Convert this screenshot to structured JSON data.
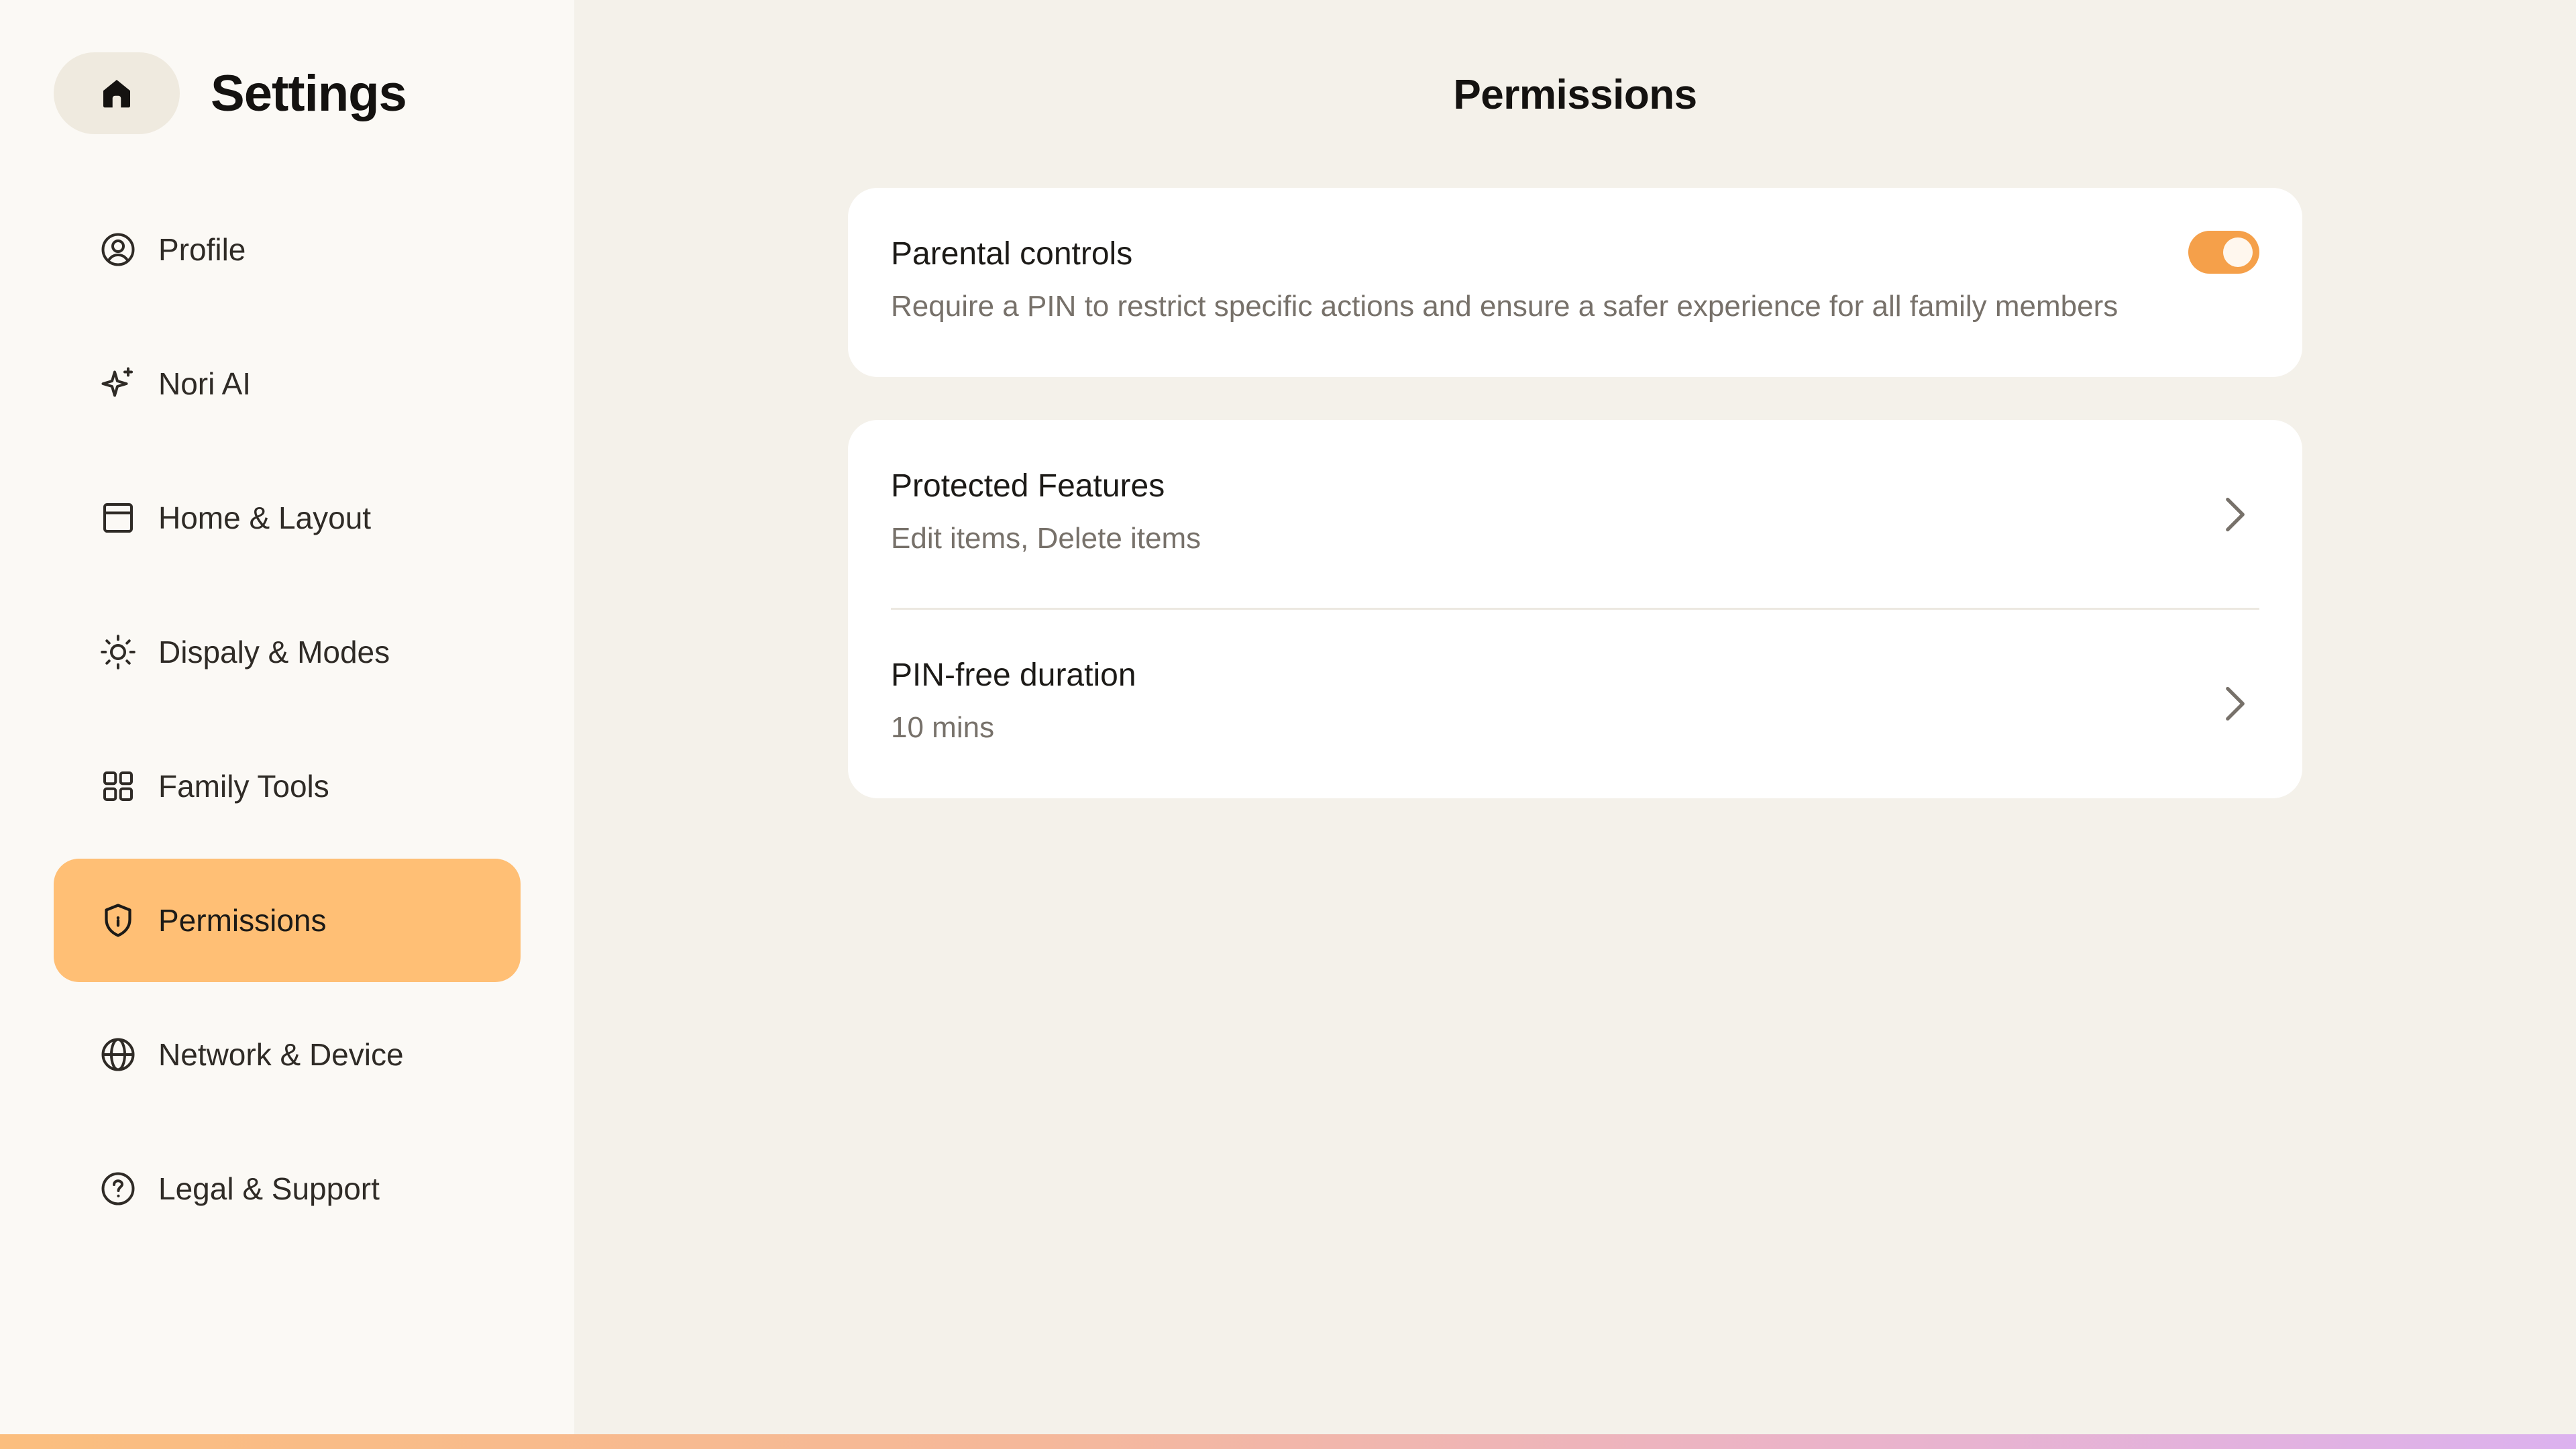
{
  "sidebar": {
    "title": "Settings",
    "home_icon": "home-icon",
    "items": [
      {
        "label": "Profile",
        "icon": "user-circle-icon",
        "active": false
      },
      {
        "label": "Nori AI",
        "icon": "sparkle-icon",
        "active": false
      },
      {
        "label": "Home & Layout",
        "icon": "layout-icon",
        "active": false
      },
      {
        "label": "Dispaly & Modes",
        "icon": "sun-icon",
        "active": false
      },
      {
        "label": "Family Tools",
        "icon": "grid-icon",
        "active": false
      },
      {
        "label": "Permissions",
        "icon": "shield-icon",
        "active": true
      },
      {
        "label": "Network & Device",
        "icon": "globe-icon",
        "active": false
      },
      {
        "label": "Legal & Support",
        "icon": "help-circle-icon",
        "active": false
      }
    ]
  },
  "main": {
    "title": "Permissions",
    "parental": {
      "title": "Parental controls",
      "description": "Require a PIN to restrict specific actions and ensure a safer experience for all family members",
      "enabled": true
    },
    "rows": [
      {
        "title": "Protected Features",
        "value": "Edit items, Delete items"
      },
      {
        "title": "PIN-free duration",
        "value": "10 mins"
      }
    ]
  },
  "colors": {
    "accent": "#ffbf75",
    "toggle_on": "#f5a04a",
    "sidebar_bg": "#fbf9f5",
    "main_bg": "#f4f1ea"
  }
}
